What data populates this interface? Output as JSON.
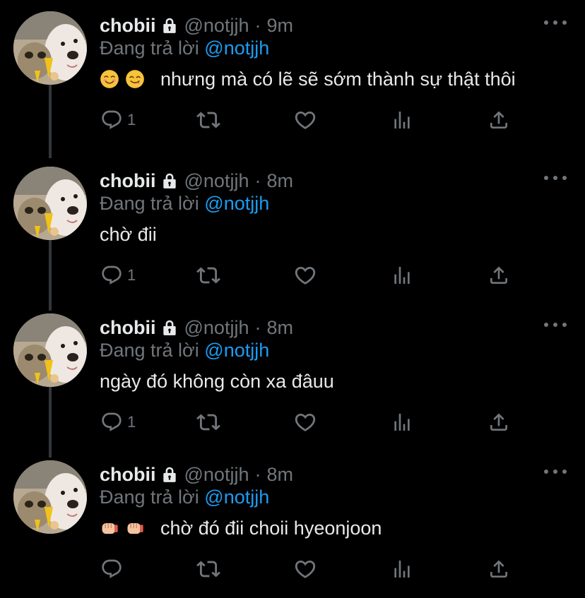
{
  "tweets": [
    {
      "name": "chobii",
      "handle": "@notjjh",
      "separator": "·",
      "time": "9m",
      "reply_prefix": "Đang trả lời",
      "reply_to": "@notjjh",
      "emojis": [
        "smiling-face-emoji",
        "yum-face-emoji"
      ],
      "text": "nhưng mà có lẽ sẽ sớm thành sự thật thôi",
      "reply_count": "1"
    },
    {
      "name": "chobii",
      "handle": "@notjjh",
      "separator": "·",
      "time": "8m",
      "reply_prefix": "Đang trả lời",
      "reply_to": "@notjjh",
      "emojis": [],
      "text": "chờ đii",
      "reply_count": "1"
    },
    {
      "name": "chobii",
      "handle": "@notjjh",
      "separator": "·",
      "time": "8m",
      "reply_prefix": "Đang trả lời",
      "reply_to": "@notjjh",
      "emojis": [],
      "text": "ngày đó không còn xa đâuu",
      "reply_count": "1"
    },
    {
      "name": "chobii",
      "handle": "@notjjh",
      "separator": "·",
      "time": "8m",
      "reply_prefix": "Đang trả lời",
      "reply_to": "@notjjh",
      "emojis": [
        "fist-bump-emoji",
        "fist-bump-emoji"
      ],
      "text": "chờ đó đii choii hyeonjoon",
      "reply_count": ""
    }
  ],
  "colors": {
    "background": "#000000",
    "text_primary": "#e7e9ea",
    "text_secondary": "#71767b",
    "accent": "#1d9bf0",
    "thread_line": "#333639"
  },
  "icons": {
    "lock": "lock-icon",
    "more": "more-icon",
    "reply": "reply-icon",
    "retweet": "retweet-icon",
    "like": "heart-icon",
    "analytics": "analytics-icon",
    "share": "share-icon"
  }
}
